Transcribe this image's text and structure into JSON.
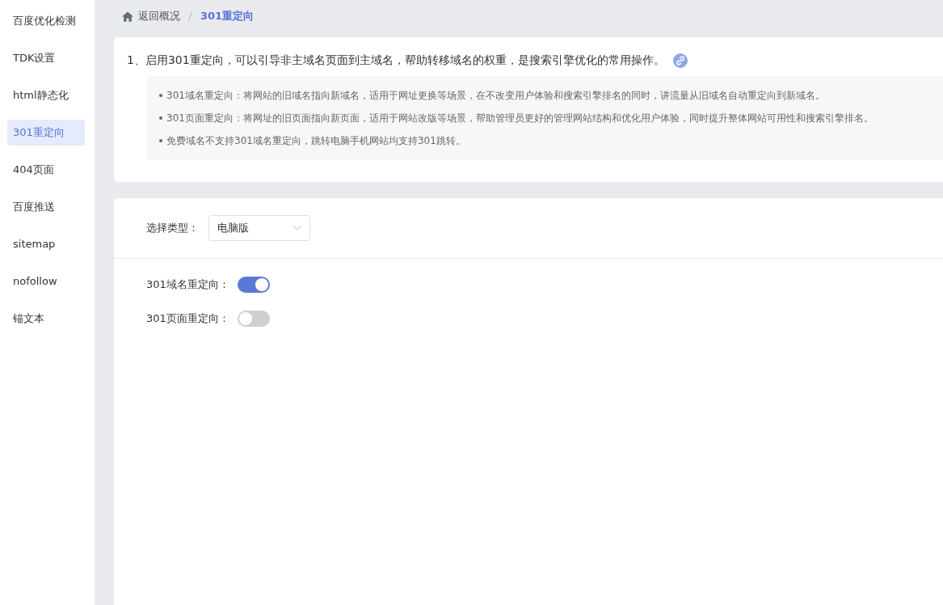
{
  "sidebar": {
    "items": [
      {
        "label": "百度优化检测",
        "selected": false
      },
      {
        "label": "TDK设置",
        "selected": false
      },
      {
        "label": "html静态化",
        "selected": false
      },
      {
        "label": "301重定向",
        "selected": true
      },
      {
        "label": "404页面",
        "selected": false
      },
      {
        "label": "百度推送",
        "selected": false
      },
      {
        "label": "sitemap",
        "selected": false
      },
      {
        "label": "nofollow",
        "selected": false
      },
      {
        "label": "锚文本",
        "selected": false
      }
    ]
  },
  "breadcrumb": {
    "back": "返回概况",
    "current": "301重定向"
  },
  "intro": {
    "heading": "1、启用301重定向，可以引导非主域名页面到主域名，帮助转移域名的权重，是搜索引擎优化的常用操作。",
    "notes": [
      "301域名重定向：将网站的旧域名指向新域名，适用于网址更换等场景，在不改变用户体验和搜索引擎排名的同时，讲流量从旧域名自动重定向到新域名。",
      "301页面重定向：将网址的旧页面指向新页面，适用于网站改版等场景，帮助管理员更好的管理网站结构和优化用户体验，同时提升整体网站可用性和搜索引擎排名。",
      "免费域名不支持301域名重定向，跳转电脑手机网站均支持301跳转。"
    ]
  },
  "settings": {
    "type_label": "选择类型：",
    "type_value": "电脑版",
    "switches": [
      {
        "label": "301域名重定向：",
        "on": true
      },
      {
        "label": "301页面重定向：",
        "on": false
      }
    ]
  }
}
